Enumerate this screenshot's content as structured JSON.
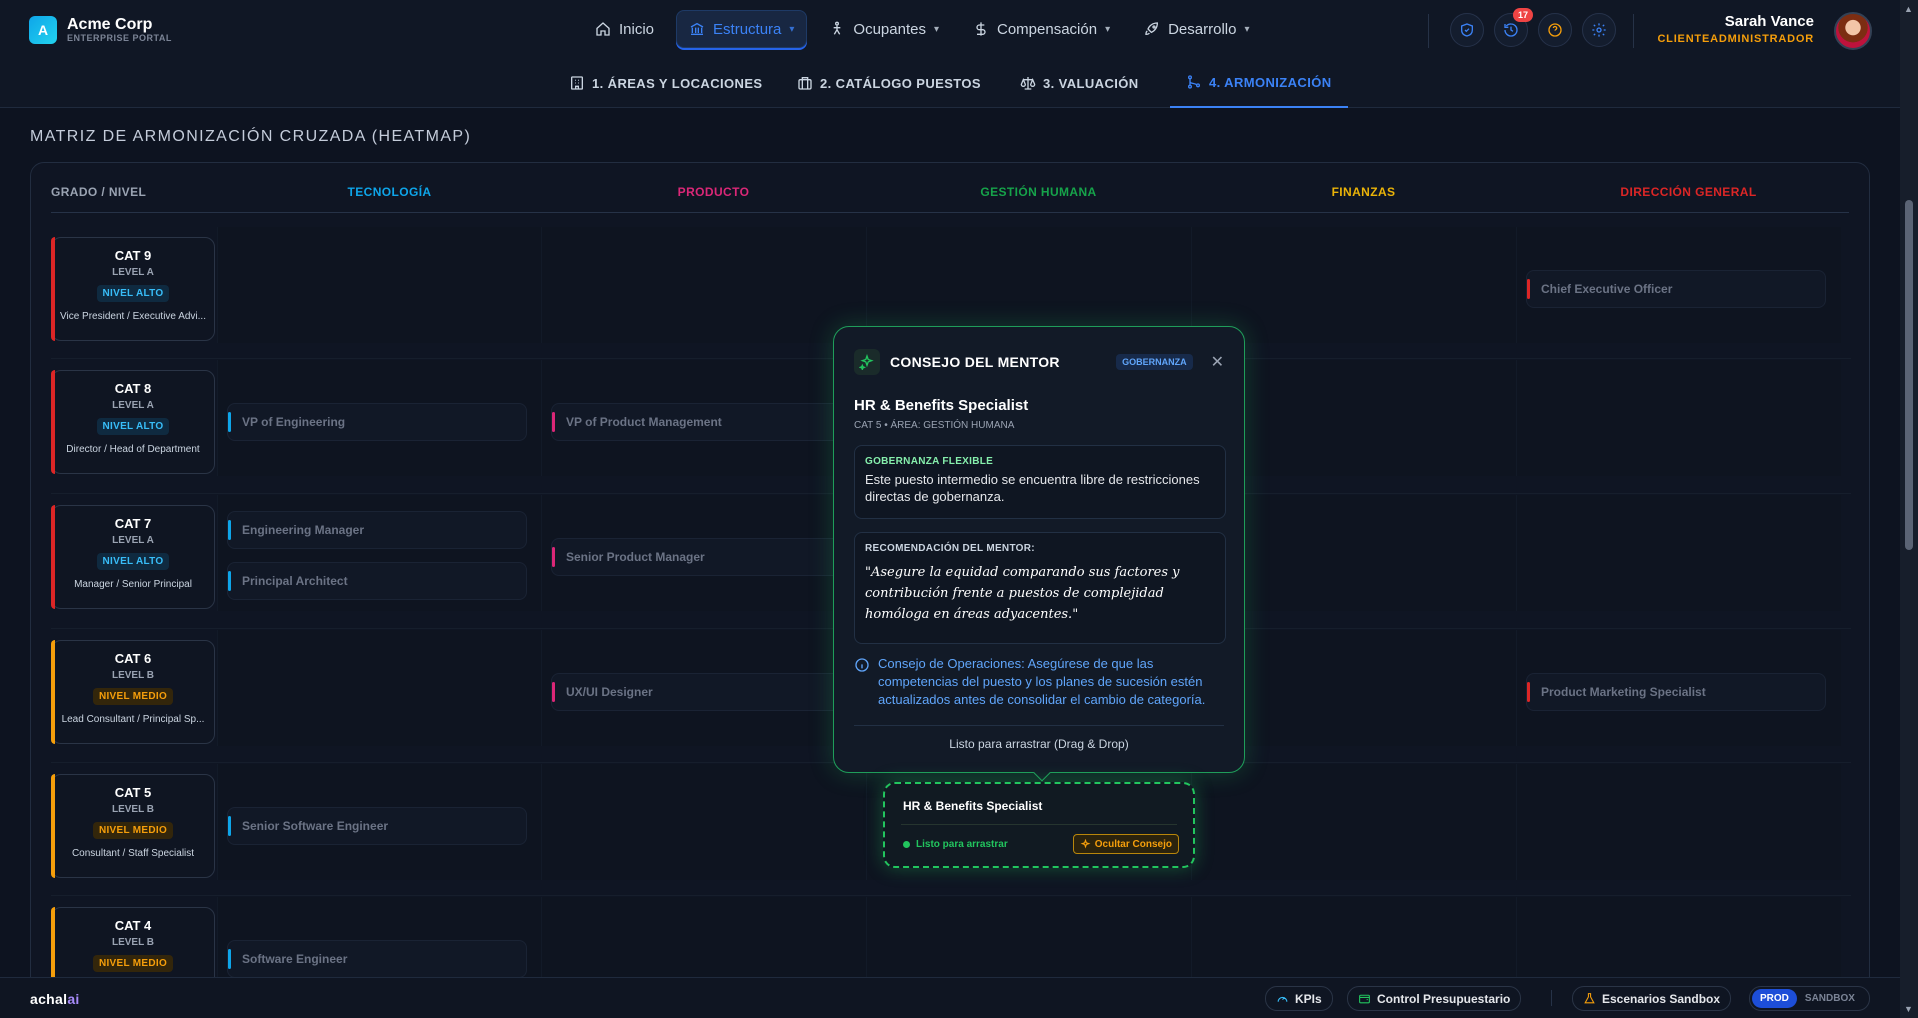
{
  "brand": {
    "logo_letter": "A",
    "name": "Acme Corp",
    "subtitle": "ENTERPRISE PORTAL"
  },
  "main_nav": [
    {
      "label": "Inicio",
      "icon": "home-icon"
    },
    {
      "label": "Estructura",
      "icon": "building-columns-icon",
      "active": true
    },
    {
      "label": "Ocupantes",
      "icon": "person-icon"
    },
    {
      "label": "Compensación",
      "icon": "dollar-icon"
    },
    {
      "label": "Desarrollo",
      "icon": "rocket-icon"
    }
  ],
  "header_icons": {
    "notifications_count": "17"
  },
  "user": {
    "name": "Sarah Vance",
    "role": "CLIENTEADMINISTRADOR"
  },
  "sub_nav": [
    {
      "label": "1. ÁREAS Y LOCACIONES"
    },
    {
      "label": "2. CATÁLOGO PUESTOS"
    },
    {
      "label": "3. VALUACIÓN"
    },
    {
      "label": "4. ARMONIZACIÓN",
      "active": true
    }
  ],
  "section_title": "MATRIZ DE ARMONIZACIÓN CRUZADA (HEATMAP)",
  "matrix": {
    "grade_header": "GRADO / NIVEL",
    "columns": [
      {
        "label": "TECNOLOGÍA",
        "color": "#0ea5e9"
      },
      {
        "label": "PRODUCTO",
        "color": "#db2777"
      },
      {
        "label": "GESTIÓN HUMANA",
        "color": "#16a34a"
      },
      {
        "label": "FINANZAS",
        "color": "#eab308"
      },
      {
        "label": "DIRECCIÓN GENERAL",
        "color": "#dc2626"
      }
    ],
    "rows": [
      {
        "cat": "CAT 9",
        "level": "LEVEL A",
        "tier": "NIVEL ALTO",
        "desc": "Vice President / Executive Advi...",
        "color": "#dc2626",
        "jobs": {
          "dir": [
            "Chief Executive Officer"
          ]
        }
      },
      {
        "cat": "CAT 8",
        "level": "LEVEL A",
        "tier": "NIVEL ALTO",
        "desc": "Director / Head of Department",
        "color": "#dc2626",
        "jobs": {
          "tec": [
            "VP of Engineering"
          ],
          "prod": [
            "VP of Product Management"
          ]
        }
      },
      {
        "cat": "CAT 7",
        "level": "LEVEL A",
        "tier": "NIVEL ALTO",
        "desc": "Manager / Senior Principal",
        "color": "#dc2626",
        "jobs": {
          "tec": [
            "Engineering Manager",
            "Principal Architect"
          ],
          "prod": [
            "Senior Product Manager"
          ]
        }
      },
      {
        "cat": "CAT 6",
        "level": "LEVEL B",
        "tier": "NIVEL MEDIO",
        "desc": "Lead Consultant / Principal Sp...",
        "color": "#f59e0b",
        "jobs": {
          "prod": [
            "UX/UI Designer"
          ],
          "dir": [
            "Product Marketing Specialist"
          ]
        }
      },
      {
        "cat": "CAT 5",
        "level": "LEVEL B",
        "tier": "NIVEL MEDIO",
        "desc": "Consultant / Staff Specialist",
        "color": "#f59e0b",
        "jobs": {
          "tec": [
            "Senior Software Engineer"
          ]
        }
      },
      {
        "cat": "CAT 4",
        "level": "LEVEL B",
        "tier": "NIVEL MEDIO",
        "desc": "",
        "color": "#f59e0b",
        "jobs": {
          "tec": [
            "Software Engineer"
          ]
        }
      }
    ]
  },
  "mentor": {
    "title": "CONSEJO DEL MENTOR",
    "tag": "GOBERNANZA",
    "job_title": "HR & Benefits Specialist",
    "meta": "CAT 5 • ÁREA: GESTIÓN HUMANA",
    "governance_label": "GOBERNANZA FLEXIBLE",
    "governance_text": "Este puesto intermedio se encuentra libre de restricciones directas de gobernanza.",
    "recommendation_label": "RECOMENDACIÓN DEL MENTOR:",
    "recommendation_text": "\"Asegure la equidad comparando sus factores y contribución frente a puestos de complejidad homóloga en áreas adyacentes.\"",
    "ops_text": "Consejo de Operaciones: Asegúrese de que las competencias del puesto y los planes de sucesión estén actualizados antes de consolidar el cambio de categoría.",
    "footer": "Listo para arrastrar (Drag & Drop)"
  },
  "drag_card": {
    "title": "HR & Benefits Specialist",
    "status": "Listo para arrastrar",
    "button": "Ocultar Consejo"
  },
  "footer": {
    "brand_a": "achal",
    "brand_b": "ai",
    "kpis": "KPIs",
    "budget": "Control Presupuestario",
    "sandbox": "Escenarios Sandbox",
    "env_prod": "PROD",
    "env_sandbox": "SANDBOX"
  }
}
